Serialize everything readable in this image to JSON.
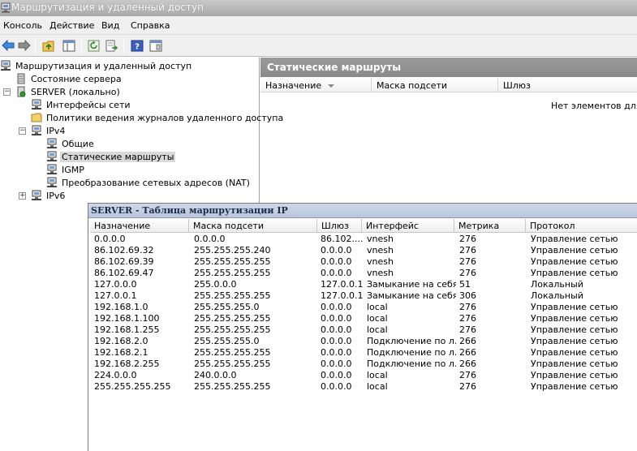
{
  "window": {
    "title": "Маршрутизация и удаленный доступ"
  },
  "menu": [
    "Консоль",
    "Действие",
    "Вид",
    "Справка"
  ],
  "toolbar": {
    "buttons": [
      "back-icon",
      "forward-icon",
      "up-folder-icon",
      "show-hide-tree-icon",
      "refresh-icon",
      "export-list-icon",
      "help-icon",
      "properties-icon"
    ]
  },
  "tree": {
    "root": "Маршрутизация и удаленный доступ",
    "server_status": "Состояние сервера",
    "server": "SERVER (локально)",
    "network_interfaces": "Интерфейсы сети",
    "logging_policies": "Политики ведения журналов удаленного доступа",
    "ipv4": "IPv4",
    "general": "Общие",
    "static_routes": "Статические маршруты",
    "igmp": "IGMP",
    "nat": "Преобразование сетевых адресов (NAT)",
    "ipv6": "IPv6",
    "expand_minus": "−",
    "expand_plus": "+"
  },
  "result_pane": {
    "title": "Статические маршруты",
    "columns": [
      "Назначение",
      "Маска подсети",
      "Шлюз"
    ],
    "empty_message": "Нет элементов для о"
  },
  "dialog": {
    "title": "SERVER - Таблица маршрутизации IP",
    "columns": [
      "Назначение",
      "Маска подсети",
      "Шлюз",
      "Интерфейс",
      "Метрика",
      "Протокол"
    ],
    "rows": [
      [
        "0.0.0.0",
        "0.0.0.0",
        "86.102....",
        "vnesh",
        "276",
        "Управление сетью"
      ],
      [
        "86.102.69.32",
        "255.255.255.240",
        "0.0.0.0",
        "vnesh",
        "276",
        "Управление сетью"
      ],
      [
        "86.102.69.39",
        "255.255.255.255",
        "0.0.0.0",
        "vnesh",
        "276",
        "Управление сетью"
      ],
      [
        "86.102.69.47",
        "255.255.255.255",
        "0.0.0.0",
        "vnesh",
        "276",
        "Управление сетью"
      ],
      [
        "127.0.0.0",
        "255.0.0.0",
        "127.0.0.1",
        "Замыкание на себя",
        "51",
        "Локальный"
      ],
      [
        "127.0.0.1",
        "255.255.255.255",
        "127.0.0.1",
        "Замыкание на себя",
        "306",
        "Локальный"
      ],
      [
        "192.168.1.0",
        "255.255.255.0",
        "0.0.0.0",
        "local",
        "276",
        "Управление сетью"
      ],
      [
        "192.168.1.100",
        "255.255.255.255",
        "0.0.0.0",
        "local",
        "276",
        "Управление сетью"
      ],
      [
        "192.168.1.255",
        "255.255.255.255",
        "0.0.0.0",
        "local",
        "276",
        "Управление сетью"
      ],
      [
        "192.168.2.0",
        "255.255.255.0",
        "0.0.0.0",
        "Подключение по л...",
        "266",
        "Управление сетью"
      ],
      [
        "192.168.2.1",
        "255.255.255.255",
        "0.0.0.0",
        "Подключение по л...",
        "266",
        "Управление сетью"
      ],
      [
        "192.168.2.255",
        "255.255.255.255",
        "0.0.0.0",
        "Подключение по л...",
        "266",
        "Управление сетью"
      ],
      [
        "224.0.0.0",
        "240.0.0.0",
        "0.0.0.0",
        "local",
        "276",
        "Управление сетью"
      ],
      [
        "255.255.255.255",
        "255.255.255.255",
        "0.0.0.0",
        "local",
        "276",
        "Управление сетью"
      ]
    ]
  }
}
